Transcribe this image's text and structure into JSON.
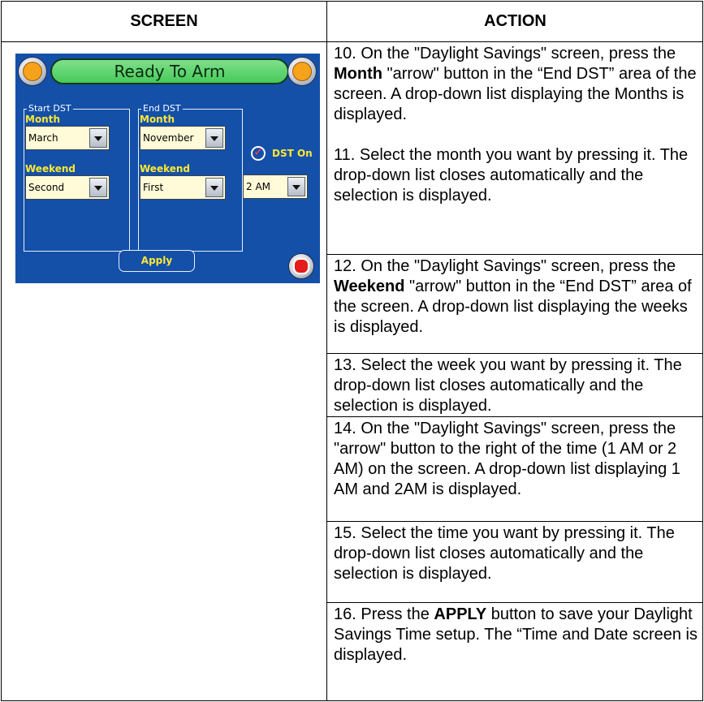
{
  "table": {
    "header_screen": "SCREEN",
    "header_action": "ACTION"
  },
  "device": {
    "status_text": "Ready To Arm",
    "start_group_title": "Start DST",
    "end_group_title": "End DST",
    "month_label": "Month",
    "weekend_label": "Weekend",
    "start_month": "March",
    "start_weekend": "Second",
    "end_month": "November",
    "end_weekend": "First",
    "time_value": "2 AM",
    "dst_on_label": "DST On",
    "apply_label": "Apply",
    "icons": {
      "home": "home-icon",
      "back": "back-arrow-icon",
      "stop": "stop-icon",
      "dropdown": "chevron-down-icon",
      "check": "checkmark-icon"
    }
  },
  "steps": [
    {
      "pre": "10. On the \"Daylight Savings\" screen, press the ",
      "bold": "Month",
      "post": " \"arrow\" button in the “End DST” area of the screen. A drop-down list displaying the Months is displayed."
    },
    {
      "text": "11. Select the month you want by pressing it. The drop-down list closes automatically and the selection is displayed."
    },
    {
      "pre": "12. On the \"Daylight Savings\" screen, press the ",
      "bold": "Weekend",
      "post": " \"arrow\" button in the “End DST” area of the screen. A drop-down list displaying the weeks is displayed."
    },
    {
      "text": "13. Select the week you want by pressing it. The drop-down list closes automatically and the selection is displayed."
    },
    {
      "text": "14. On the \"Daylight Savings\" screen, press the \"arrow\" button to the right of the time (1 AM or 2 AM) on the screen. A drop-down list displaying 1 AM and 2AM is displayed."
    },
    {
      "text": "15. Select the time you want by pressing it. The drop-down list closes automatically and the selection is displayed."
    },
    {
      "pre": "16. Press the ",
      "bold": "APPLY",
      "post": " button to save your Daylight Savings Time setup. The “Time and Date screen is displayed."
    }
  ]
}
